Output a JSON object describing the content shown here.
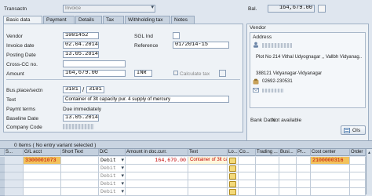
{
  "header": {
    "transaction_label": "Transactn",
    "transaction_value": "Invoice",
    "balance_label": "Bal.",
    "balance_value": "164,679.00"
  },
  "tabs": [
    "Basic data",
    "Payment",
    "Details",
    "Tax",
    "Withholding tax",
    "Notes"
  ],
  "basic": {
    "vendor_label": "Vendor",
    "vendor_value": "1001452",
    "sgl_label": "SGL Ind",
    "invoice_date_label": "Invoice date",
    "invoice_date_value": "02.04.2014",
    "reference_label": "Reference",
    "reference_value": "01/2014-15",
    "posting_date_label": "Posting Date",
    "posting_date_value": "13.05.2014",
    "crosscc_label": "Cross-CC no.",
    "amount_label": "Amount",
    "amount_value": "164,679.00",
    "currency_value": "INR",
    "calc_tax_label": "Calculate tax",
    "busplace_label": "Bus.place/sectn",
    "busplace_value": "3101",
    "section_value": "3101",
    "text_label": "Text",
    "text_value": "Container of 3lt capacity pur. 4 supply of mercury",
    "payterms_label": "Paymt terms",
    "payterms_value": "Due immediately",
    "baseline_label": "Baseline Date",
    "baseline_value": "13.05.2014",
    "company_label": "Company Code"
  },
  "vendor_panel": {
    "title": "Vendor",
    "address_title": "Address",
    "addr_line1": "Plot No 214 Vithal Udyognagar ,, Vallbh Vidyanag..",
    "addr_line2": "388121 Vidyanagar-Vidyanagar",
    "phone": "02692-230531",
    "bank_label": "Bank Data:",
    "bank_value": "Not available",
    "ois_label": "OIs"
  },
  "table": {
    "status": "0 Items ( No entry variant selected )",
    "columns": [
      "S...",
      "G/L acct",
      "Short Text",
      "D/C",
      "Amount in doc.curr.",
      "Text",
      "Lo...",
      "Co...",
      "Trading ...",
      "Busi...",
      "Pr...",
      "Cost center",
      "Order"
    ],
    "rows": [
      {
        "gl": "3300001073",
        "dc": "Debit",
        "amount": "164,679.00",
        "text": "Container of 3lt capa",
        "cost_center": "2100000316"
      },
      {
        "gl": "",
        "dc": "Debit",
        "amount": "",
        "text": "",
        "cost_center": ""
      },
      {
        "gl": "",
        "dc": "Debit",
        "amount": "",
        "text": "",
        "cost_center": ""
      },
      {
        "gl": "",
        "dc": "Debit",
        "amount": "",
        "text": "",
        "cost_center": ""
      },
      {
        "gl": "",
        "dc": "Debit",
        "amount": "",
        "text": "",
        "cost_center": ""
      }
    ]
  },
  "colors": {
    "selected_cell": "#f2c25b",
    "required_value": "#c00000"
  }
}
